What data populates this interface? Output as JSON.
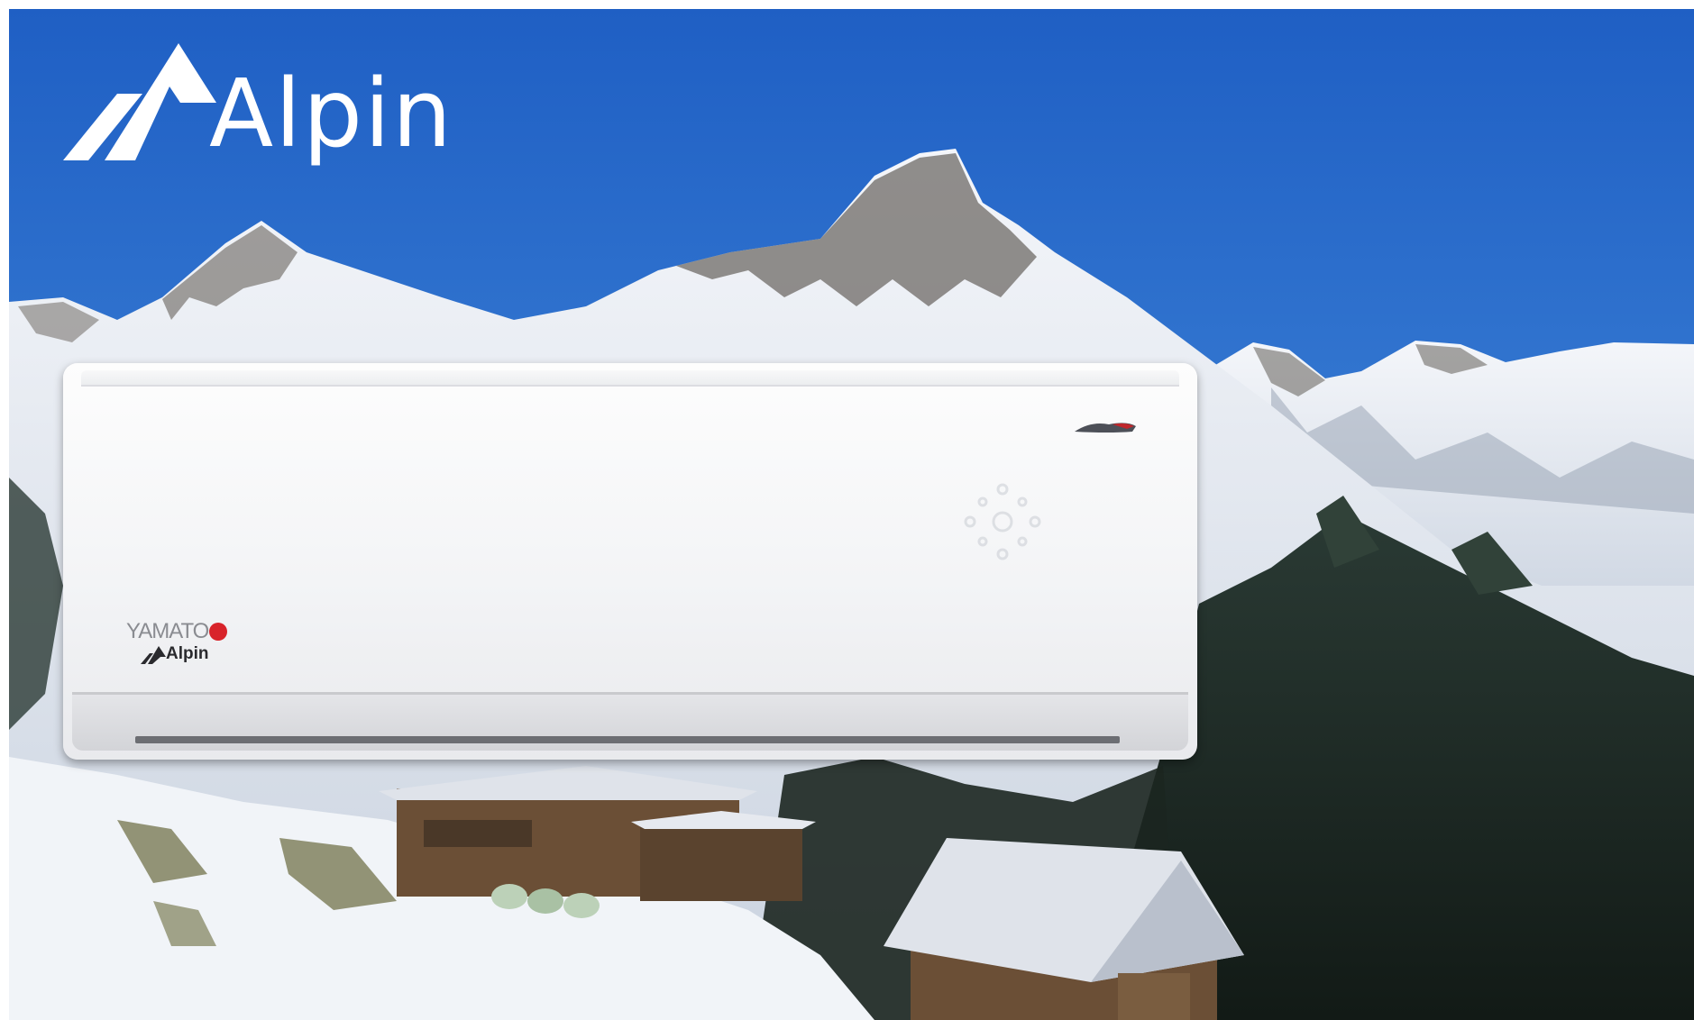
{
  "brand": {
    "name": "Alpin",
    "color": "#ffffff"
  },
  "product": {
    "maker": "YAMATO",
    "series": "Alpin",
    "type": "wall-mounted-air-conditioner",
    "icons": [
      "mountain-logo-icon",
      "rising-sun-icon",
      "led-display-icon",
      "badge-icon"
    ]
  },
  "scene": {
    "sky_color": "#2f6fcc",
    "snow_color": "#eef2f7",
    "forest_color": "#1e2a24",
    "wood_color": "#6b4f36"
  }
}
